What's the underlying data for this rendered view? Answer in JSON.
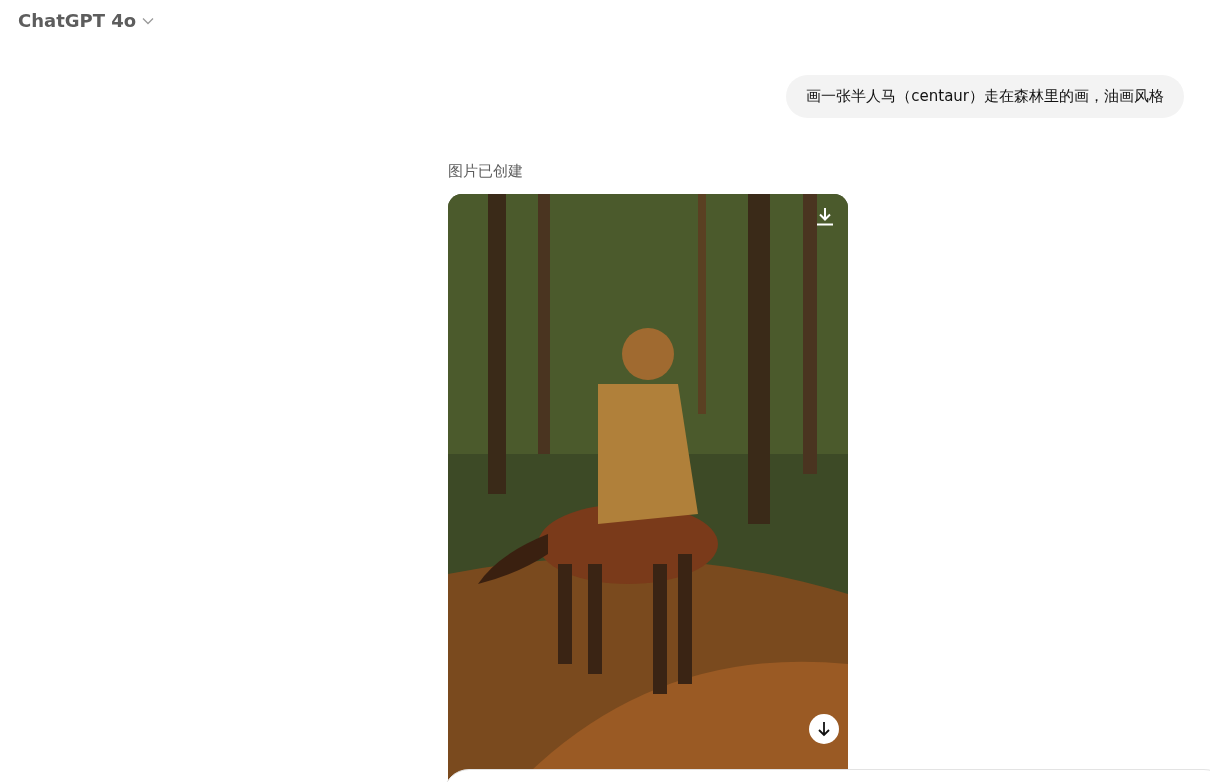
{
  "header": {
    "model": "ChatGPT 4o"
  },
  "user_message": "画一张半人马（centaur）走在森林里的画，油画风格",
  "assistant": {
    "status": "图片已创建"
  }
}
